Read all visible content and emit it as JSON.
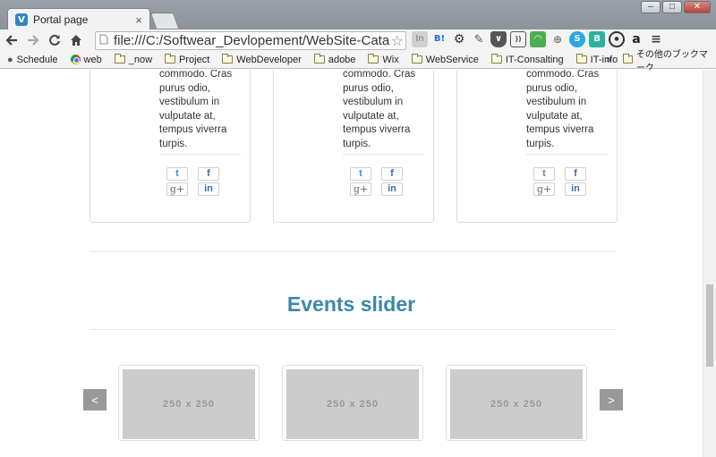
{
  "browser": {
    "tab_title": "Portal page",
    "tab_favicon": "V",
    "tab_close": "×",
    "window_controls": {
      "minimize": "–",
      "maximize": "□",
      "close": "✕"
    },
    "url": "file:///C:/Softwear_Devlopement/WebSite-Catal",
    "bookmarks": [
      {
        "label": "Schedule",
        "icon": "apple-icon"
      },
      {
        "label": "web",
        "icon": "chrome-icon"
      },
      {
        "label": "_now",
        "icon": "folder-icon"
      },
      {
        "label": "Project",
        "icon": "folder-icon"
      },
      {
        "label": "WebDeveloper",
        "icon": "folder-icon"
      },
      {
        "label": "adobe",
        "icon": "folder-icon"
      },
      {
        "label": "Wix",
        "icon": "folder-icon"
      },
      {
        "label": "WebService",
        "icon": "folder-icon"
      },
      {
        "label": "IT-Consalting",
        "icon": "folder-icon"
      },
      {
        "label": "IT-info",
        "icon": "folder-icon"
      }
    ],
    "bookmarks_overflow": "»",
    "other_bookmarks": "その他のブックマーク"
  },
  "cards": [
    {
      "text": "commodo. Cras purus odio, vestibulum in vulputate at, tempus viverra turpis."
    },
    {
      "text": "commodo. Cras purus odio, vestibulum in vulputate at, tempus viverra turpis."
    },
    {
      "text": "commodo. Cras purus odio, vestibulum in vulputate at, tempus viverra turpis."
    }
  ],
  "social": {
    "twitter": "t",
    "facebook": "f",
    "google_plus": "g+",
    "linkedin": "in"
  },
  "events": {
    "title": "Events slider",
    "prev_label": "<",
    "next_label": ">",
    "slides": [
      {
        "label": "250 x 250"
      },
      {
        "label": "250 x 250"
      },
      {
        "label": "250 x 250"
      }
    ]
  },
  "colors": {
    "accent": "#3d87a8",
    "placeholder": "#cccccc",
    "slider_button": "#999999"
  }
}
